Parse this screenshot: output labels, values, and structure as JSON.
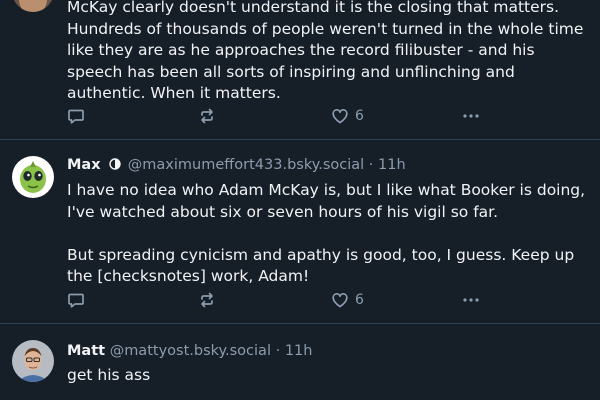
{
  "posts": [
    {
      "text": [
        "McKay clearly doesn't understand it is the closing that matters. Hundreds of thousands of people weren't turned in the whole time like they are as he approaches the record filibuster - and his speech has been all sorts of inspiring and unflinching and authentic. When it matters."
      ],
      "likes": "6",
      "more_icon": "ellipsis-icon"
    },
    {
      "author_name": "Max",
      "handle": "@maximumeffort433.bsky.social",
      "separator": "·",
      "time": "11h",
      "text": [
        "I have no idea who Adam McKay is, but I like what Booker is doing, I've watched about six or seven hours of his vigil so far.",
        "But spreading cynicism and apathy is good, too, I guess.  Keep up the [checksnotes] work, Adam!"
      ],
      "likes": "6"
    },
    {
      "author_name": "Matt",
      "handle": "@mattyost.bsky.social",
      "separator": "·",
      "time": "11h",
      "text": [
        "get his ass"
      ]
    }
  ],
  "colors": {
    "background": "#161e27",
    "divider": "#2e4052",
    "text": "#f1f3f5",
    "muted": "#8c9cae"
  },
  "icons": [
    "reply-icon",
    "repost-icon",
    "like-icon",
    "ellipsis-icon",
    "verified-badge-icon"
  ]
}
